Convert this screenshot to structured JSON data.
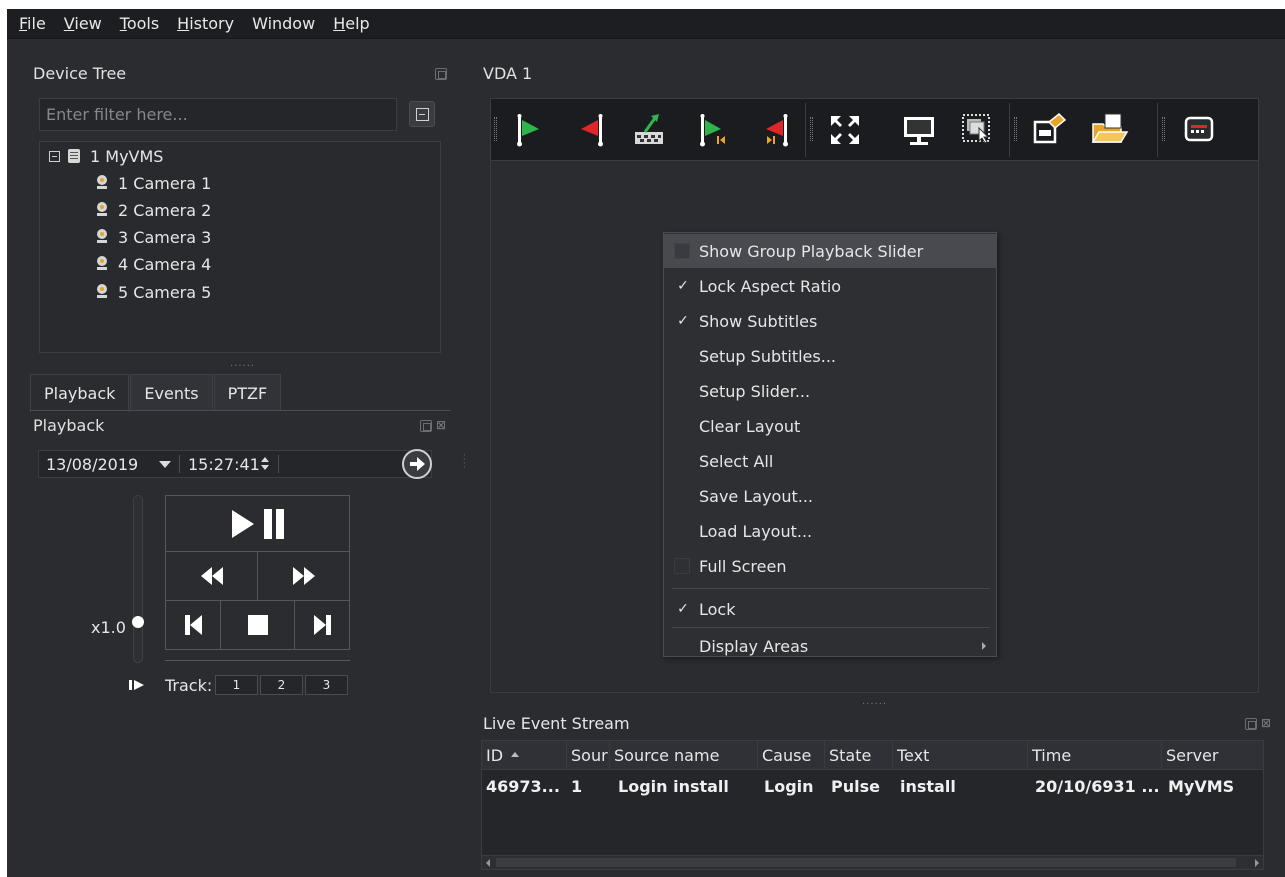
{
  "menubar": {
    "items": [
      {
        "label": "File",
        "mnemonic": "F",
        "rest": "ile"
      },
      {
        "label": "View",
        "mnemonic": "V",
        "rest": "iew"
      },
      {
        "label": "Tools",
        "mnemonic": "T",
        "rest": "ools"
      },
      {
        "label": "History",
        "mnemonic": "H",
        "rest": "istory"
      },
      {
        "label": "Window",
        "mnemonic": "",
        "rest": "Window"
      },
      {
        "label": "Help",
        "mnemonic": "H",
        "rest": "elp"
      }
    ]
  },
  "device_tree": {
    "title": "Device Tree",
    "filter_placeholder": "Enter filter here...",
    "root": {
      "label": "1 MyVMS",
      "expanded": true
    },
    "cameras": [
      "1 Camera 1",
      "2 Camera 2",
      "3 Camera 3",
      "4 Camera 4",
      "5 Camera 5"
    ]
  },
  "tabs": [
    {
      "label": "Playback",
      "active": true
    },
    {
      "label": "Events",
      "active": false
    },
    {
      "label": "PTZF",
      "active": false
    }
  ],
  "playback": {
    "title": "Playback",
    "date": "13/08/2019",
    "time": "15:27:41",
    "speed": "x1.0",
    "track_label": "Track:",
    "tracks": [
      "1",
      "2",
      "3"
    ]
  },
  "vda": {
    "title": "VDA 1",
    "toolbar_icons": [
      "start-bookmark-green-flag-icon",
      "end-bookmark-red-flag-icon",
      "export-clip-icon",
      "go-to-start-bookmark-icon",
      "go-to-end-bookmark-icon",
      "fullscreen-icon",
      "monitor-icon",
      "select-area-icon",
      "save-layout-icon",
      "load-layout-icon",
      "settings-panel-icon"
    ]
  },
  "context_menu": {
    "items": [
      {
        "label": "Show Group Playback Slider",
        "check": "box",
        "highlighted": true
      },
      {
        "label": "Lock Aspect Ratio",
        "check": "✓"
      },
      {
        "label": "Show Subtitles",
        "check": "✓"
      },
      {
        "label": "Setup Subtitles...",
        "check": ""
      },
      {
        "label": "Setup Slider...",
        "check": ""
      },
      {
        "label": "Clear Layout",
        "check": ""
      },
      {
        "label": "Select All",
        "check": ""
      },
      {
        "label": "Save Layout...",
        "check": ""
      },
      {
        "label": "Load Layout...",
        "check": ""
      },
      {
        "label": "Full Screen",
        "check": "box-dark"
      },
      {
        "label": "Lock",
        "check": "✓"
      },
      {
        "label": "Display Areas",
        "check": "",
        "submenu": true
      }
    ]
  },
  "live_event_stream": {
    "title": "Live Event Stream",
    "columns": [
      "ID",
      "Sour",
      "Source name",
      "Cause",
      "State",
      "Text",
      "Time",
      "Server"
    ],
    "rows": [
      [
        "46973...",
        "1",
        "Login install",
        "Login",
        "Pulse",
        "install",
        "20/10/6931 ...",
        "MyVMS"
      ]
    ]
  },
  "colors": {
    "background": "#2b2c30",
    "menubar": "#1d1e21",
    "menu_highlight": "#484a50",
    "flag_green": "#2fb54a",
    "flag_red": "#e0262b"
  }
}
